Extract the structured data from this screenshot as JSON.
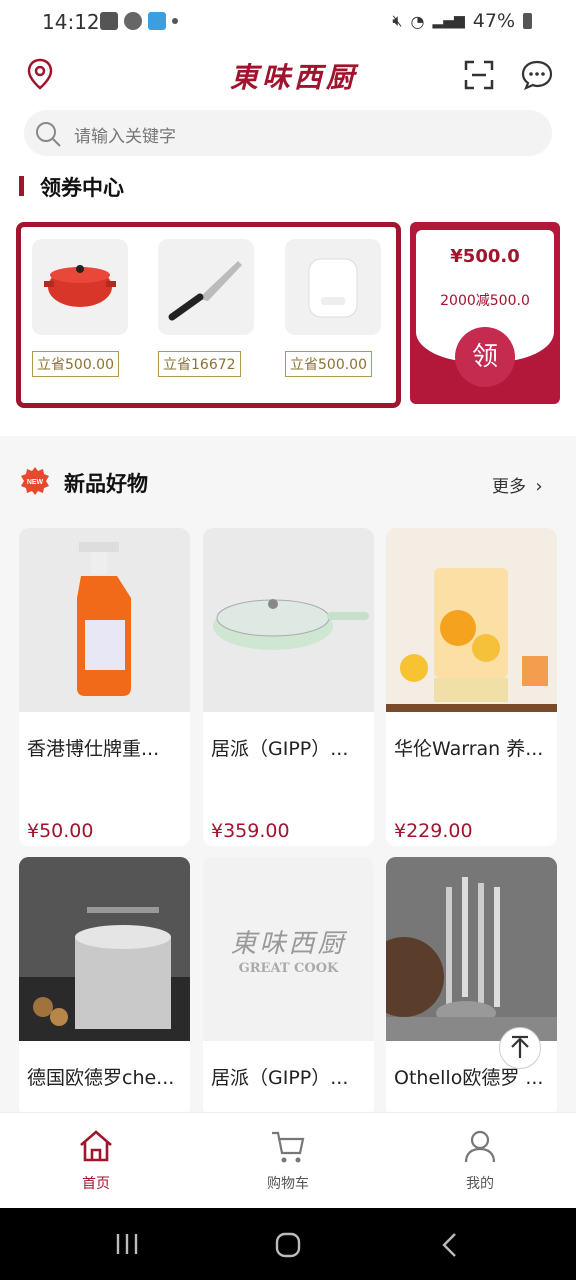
{
  "status_bar": {
    "time": "14:12",
    "battery": "47%"
  },
  "header": {
    "brand": "東味西厨",
    "search_placeholder": "请输入关键字"
  },
  "coupon_section": {
    "title": "领券中心",
    "items": [
      {
        "tag": "立省500.00",
        "icon": "red-pot"
      },
      {
        "tag": "立省16672",
        "icon": "knife"
      },
      {
        "tag": "立省500.00",
        "icon": "rice-cooker"
      }
    ],
    "card": {
      "amount": "¥500.0",
      "desc": "2000减500.0",
      "button": "领"
    }
  },
  "new_section": {
    "badge": "NEW",
    "title": "新品好物",
    "more": "更多",
    "products": [
      {
        "name": "香港博仕牌重...",
        "price": "¥50.00",
        "icon": "spray-bottle"
      },
      {
        "name": "居派（GIPP）...",
        "price": "¥359.00",
        "icon": "wok-pan"
      },
      {
        "name": "华伦Warran 养...",
        "price": "¥229.00",
        "icon": "tea-maker"
      },
      {
        "name": "德国欧德罗che...",
        "price": "",
        "icon": "steamer-pot"
      },
      {
        "name": "居派（GIPP）...",
        "price": "",
        "icon": "brand-placeholder"
      },
      {
        "name": "Othello欧德罗 ...",
        "price": "",
        "icon": "utensil-set"
      }
    ],
    "placeholder_brand": "東味西厨",
    "placeholder_sub": "GREAT COOK"
  },
  "tabbar": {
    "home": "首页",
    "cart": "购物车",
    "mine": "我的"
  },
  "colors": {
    "accent": "#a0152e"
  }
}
